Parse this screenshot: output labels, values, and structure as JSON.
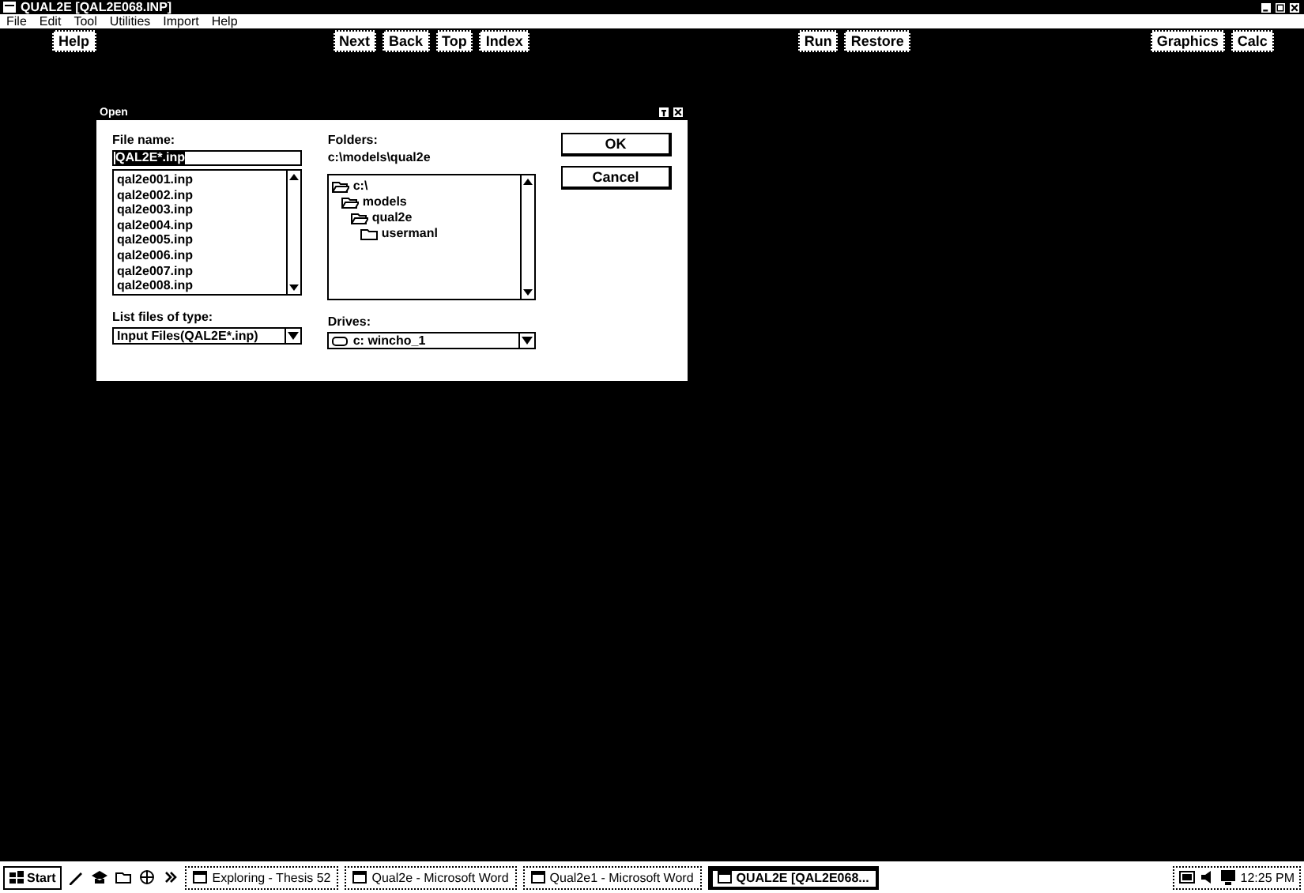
{
  "window": {
    "title": "QUAL2E [QAL2E068.INP]"
  },
  "menu": [
    "File",
    "Edit",
    "Tool",
    "Utilities",
    "Import",
    "Help"
  ],
  "toolbar": [
    [
      "Help"
    ],
    [
      "Next",
      "Back",
      "Top",
      "Index"
    ],
    [
      "Run",
      "Restore"
    ],
    [
      "Graphics",
      "Calc"
    ]
  ],
  "dialog": {
    "title": "Open",
    "file_name_label": "File name:",
    "file_name": "QAL2E*.inp",
    "file_name_selected": true,
    "files": [
      "qal2e001.inp",
      "qal2e002.inp",
      "qal2e003.inp",
      "qal2e004.inp",
      "qal2e005.inp",
      "qal2e006.inp",
      "qal2e007.inp",
      "qal2e008.inp"
    ],
    "folders_label": "Folders:",
    "folder_path": "c:\\models\\qual2e",
    "folders": [
      {
        "name": "c:\\",
        "open": true,
        "children": [
          {
            "name": "models",
            "open": true,
            "children": [
              {
                "name": "qual2e",
                "open": true,
                "children": [
                  {
                    "name": "usermanl",
                    "open": false
                  }
                ]
              }
            ]
          }
        ]
      }
    ],
    "type_label": "List files of type:",
    "type_value": "Input Files(QAL2E*.inp)",
    "drives_label": "Drives:",
    "drive_value": "c: wincho_1",
    "buttons": [
      "OK",
      "Cancel"
    ]
  },
  "taskbar": {
    "start": "Start",
    "tasks": [
      {
        "label": "Exploring - Thesis 52",
        "selected": false
      },
      {
        "label": "Qual2e - Microsoft Word",
        "selected": false
      },
      {
        "label": "Qual2e1 - Microsoft Word",
        "selected": false
      },
      {
        "label": "QUAL2E [QAL2E068...",
        "selected": true
      }
    ],
    "clock": "12:25 PM"
  }
}
